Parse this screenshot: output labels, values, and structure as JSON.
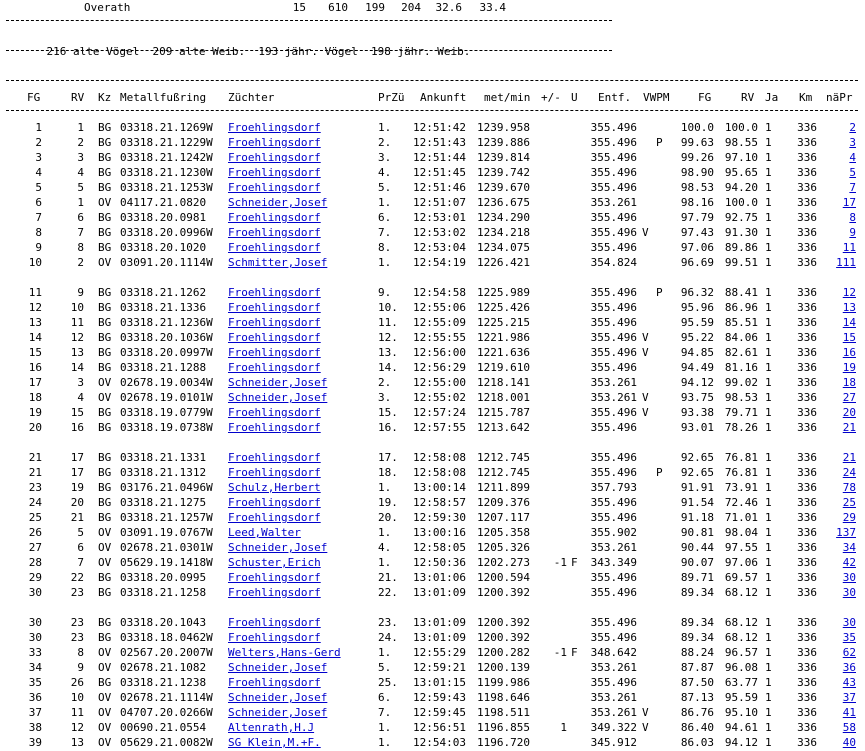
{
  "club_row": {
    "name": "Overath",
    "c1": "15",
    "c2": "610",
    "c3": "199",
    "c4": "204",
    "c5": "32.6",
    "c6": "33.4"
  },
  "summary": "216 alte Vögel  209 alte Weib.  193 jähr. Vögel  198 jähr. Weib.",
  "headers": {
    "fg": "FG",
    "rv": "RV",
    "kz": "Kz",
    "ring": "Metallfußring",
    "zuechter": "Züchter",
    "przue": "PrZü",
    "ankunft": "Ankunft",
    "metmin": "met/min",
    "pm": "+/-",
    "u": "U",
    "entf": "Entf.",
    "vwpm": "VWPM",
    "fg2": "FG",
    "rv2": "RV",
    "ja": "Ja",
    "km": "Km",
    "naepr": "näPr"
  },
  "rows": [
    {
      "fg": "1",
      "rv": "1",
      "kz": "BG",
      "ring": "03318.21.1269W",
      "breeder": "Froehlingsdorf",
      "prz": "1.",
      "time": "12:51:42",
      "speed": "1239.958",
      "pm": "",
      "u": "",
      "dist": "355.496",
      "v": "",
      "p": "",
      "fg2": "100.0",
      "rv2": "100.0",
      "ja": "1",
      "km": "336",
      "np": "2"
    },
    {
      "fg": "2",
      "rv": "2",
      "kz": "BG",
      "ring": "03318.21.1229W",
      "breeder": "Froehlingsdorf",
      "prz": "2.",
      "time": "12:51:43",
      "speed": "1239.886",
      "pm": "",
      "u": "",
      "dist": "355.496",
      "v": "",
      "p": "P",
      "fg2": "99.63",
      "rv2": "98.55",
      "ja": "1",
      "km": "336",
      "np": "3"
    },
    {
      "fg": "3",
      "rv": "3",
      "kz": "BG",
      "ring": "03318.21.1242W",
      "breeder": "Froehlingsdorf",
      "prz": "3.",
      "time": "12:51:44",
      "speed": "1239.814",
      "pm": "",
      "u": "",
      "dist": "355.496",
      "v": "",
      "p": "",
      "fg2": "99.26",
      "rv2": "97.10",
      "ja": "1",
      "km": "336",
      "np": "4"
    },
    {
      "fg": "4",
      "rv": "4",
      "kz": "BG",
      "ring": "03318.21.1230W",
      "breeder": "Froehlingsdorf",
      "prz": "4.",
      "time": "12:51:45",
      "speed": "1239.742",
      "pm": "",
      "u": "",
      "dist": "355.496",
      "v": "",
      "p": "",
      "fg2": "98.90",
      "rv2": "95.65",
      "ja": "1",
      "km": "336",
      "np": "5"
    },
    {
      "fg": "5",
      "rv": "5",
      "kz": "BG",
      "ring": "03318.21.1253W",
      "breeder": "Froehlingsdorf",
      "prz": "5.",
      "time": "12:51:46",
      "speed": "1239.670",
      "pm": "",
      "u": "",
      "dist": "355.496",
      "v": "",
      "p": "",
      "fg2": "98.53",
      "rv2": "94.20",
      "ja": "1",
      "km": "336",
      "np": "7"
    },
    {
      "fg": "6",
      "rv": "1",
      "kz": "OV",
      "ring": "04117.21.0820",
      "breeder": "Schneider,Josef",
      "prz": "1.",
      "time": "12:51:07",
      "speed": "1236.675",
      "pm": "",
      "u": "",
      "dist": "353.261",
      "v": "",
      "p": "",
      "fg2": "98.16",
      "rv2": "100.0",
      "ja": "1",
      "km": "336",
      "np": "17"
    },
    {
      "fg": "7",
      "rv": "6",
      "kz": "BG",
      "ring": "03318.20.0981",
      "breeder": "Froehlingsdorf",
      "prz": "6.",
      "time": "12:53:01",
      "speed": "1234.290",
      "pm": "",
      "u": "",
      "dist": "355.496",
      "v": "",
      "p": "",
      "fg2": "97.79",
      "rv2": "92.75",
      "ja": "1",
      "km": "336",
      "np": "8"
    },
    {
      "fg": "8",
      "rv": "7",
      "kz": "BG",
      "ring": "03318.20.0996W",
      "breeder": "Froehlingsdorf",
      "prz": "7.",
      "time": "12:53:02",
      "speed": "1234.218",
      "pm": "",
      "u": "",
      "dist": "355.496",
      "v": "V",
      "p": "",
      "fg2": "97.43",
      "rv2": "91.30",
      "ja": "1",
      "km": "336",
      "np": "9"
    },
    {
      "fg": "9",
      "rv": "8",
      "kz": "BG",
      "ring": "03318.20.1020",
      "breeder": "Froehlingsdorf",
      "prz": "8.",
      "time": "12:53:04",
      "speed": "1234.075",
      "pm": "",
      "u": "",
      "dist": "355.496",
      "v": "",
      "p": "",
      "fg2": "97.06",
      "rv2": "89.86",
      "ja": "1",
      "km": "336",
      "np": "11"
    },
    {
      "fg": "10",
      "rv": "2",
      "kz": "OV",
      "ring": "03091.20.1114W",
      "breeder": "Schmitter,Josef",
      "prz": "1.",
      "time": "12:54:19",
      "speed": "1226.421",
      "pm": "",
      "u": "",
      "dist": "354.824",
      "v": "",
      "p": "",
      "fg2": "96.69",
      "rv2": "99.51",
      "ja": "1",
      "km": "336",
      "np": "111"
    },
    {
      "fg": "11",
      "rv": "9",
      "kz": "BG",
      "ring": "03318.21.1262",
      "breeder": "Froehlingsdorf",
      "prz": "9.",
      "time": "12:54:58",
      "speed": "1225.989",
      "pm": "",
      "u": "",
      "dist": "355.496",
      "v": "",
      "p": "P",
      "fg2": "96.32",
      "rv2": "88.41",
      "ja": "1",
      "km": "336",
      "np": "12"
    },
    {
      "fg": "12",
      "rv": "10",
      "kz": "BG",
      "ring": "03318.21.1336",
      "breeder": "Froehlingsdorf",
      "prz": "10.",
      "time": "12:55:06",
      "speed": "1225.426",
      "pm": "",
      "u": "",
      "dist": "355.496",
      "v": "",
      "p": "",
      "fg2": "95.96",
      "rv2": "86.96",
      "ja": "1",
      "km": "336",
      "np": "13"
    },
    {
      "fg": "13",
      "rv": "11",
      "kz": "BG",
      "ring": "03318.21.1236W",
      "breeder": "Froehlingsdorf",
      "prz": "11.",
      "time": "12:55:09",
      "speed": "1225.215",
      "pm": "",
      "u": "",
      "dist": "355.496",
      "v": "",
      "p": "",
      "fg2": "95.59",
      "rv2": "85.51",
      "ja": "1",
      "km": "336",
      "np": "14"
    },
    {
      "fg": "14",
      "rv": "12",
      "kz": "BG",
      "ring": "03318.20.1036W",
      "breeder": "Froehlingsdorf",
      "prz": "12.",
      "time": "12:55:55",
      "speed": "1221.986",
      "pm": "",
      "u": "",
      "dist": "355.496",
      "v": "V",
      "p": "",
      "fg2": "95.22",
      "rv2": "84.06",
      "ja": "1",
      "km": "336",
      "np": "15"
    },
    {
      "fg": "15",
      "rv": "13",
      "kz": "BG",
      "ring": "03318.20.0997W",
      "breeder": "Froehlingsdorf",
      "prz": "13.",
      "time": "12:56:00",
      "speed": "1221.636",
      "pm": "",
      "u": "",
      "dist": "355.496",
      "v": "V",
      "p": "",
      "fg2": "94.85",
      "rv2": "82.61",
      "ja": "1",
      "km": "336",
      "np": "16"
    },
    {
      "fg": "16",
      "rv": "14",
      "kz": "BG",
      "ring": "03318.21.1288",
      "breeder": "Froehlingsdorf",
      "prz": "14.",
      "time": "12:56:29",
      "speed": "1219.610",
      "pm": "",
      "u": "",
      "dist": "355.496",
      "v": "",
      "p": "",
      "fg2": "94.49",
      "rv2": "81.16",
      "ja": "1",
      "km": "336",
      "np": "19"
    },
    {
      "fg": "17",
      "rv": "3",
      "kz": "OV",
      "ring": "02678.19.0034W",
      "breeder": "Schneider,Josef",
      "prz": "2.",
      "time": "12:55:00",
      "speed": "1218.141",
      "pm": "",
      "u": "",
      "dist": "353.261",
      "v": "",
      "p": "",
      "fg2": "94.12",
      "rv2": "99.02",
      "ja": "1",
      "km": "336",
      "np": "18"
    },
    {
      "fg": "18",
      "rv": "4",
      "kz": "OV",
      "ring": "02678.19.0101W",
      "breeder": "Schneider,Josef",
      "prz": "3.",
      "time": "12:55:02",
      "speed": "1218.001",
      "pm": "",
      "u": "",
      "dist": "353.261",
      "v": "V",
      "p": "",
      "fg2": "93.75",
      "rv2": "98.53",
      "ja": "1",
      "km": "336",
      "np": "27"
    },
    {
      "fg": "19",
      "rv": "15",
      "kz": "BG",
      "ring": "03318.19.0779W",
      "breeder": "Froehlingsdorf",
      "prz": "15.",
      "time": "12:57:24",
      "speed": "1215.787",
      "pm": "",
      "u": "",
      "dist": "355.496",
      "v": "V",
      "p": "",
      "fg2": "93.38",
      "rv2": "79.71",
      "ja": "1",
      "km": "336",
      "np": "20"
    },
    {
      "fg": "20",
      "rv": "16",
      "kz": "BG",
      "ring": "03318.19.0738W",
      "breeder": "Froehlingsdorf",
      "prz": "16.",
      "time": "12:57:55",
      "speed": "1213.642",
      "pm": "",
      "u": "",
      "dist": "355.496",
      "v": "",
      "p": "",
      "fg2": "93.01",
      "rv2": "78.26",
      "ja": "1",
      "km": "336",
      "np": "21"
    },
    {
      "fg": "21",
      "rv": "17",
      "kz": "BG",
      "ring": "03318.21.1331",
      "breeder": "Froehlingsdorf",
      "prz": "17.",
      "time": "12:58:08",
      "speed": "1212.745",
      "pm": "",
      "u": "",
      "dist": "355.496",
      "v": "",
      "p": "",
      "fg2": "92.65",
      "rv2": "76.81",
      "ja": "1",
      "km": "336",
      "np": "21"
    },
    {
      "fg": "21",
      "rv": "17",
      "kz": "BG",
      "ring": "03318.21.1312",
      "breeder": "Froehlingsdorf",
      "prz": "18.",
      "time": "12:58:08",
      "speed": "1212.745",
      "pm": "",
      "u": "",
      "dist": "355.496",
      "v": "",
      "p": "P",
      "fg2": "92.65",
      "rv2": "76.81",
      "ja": "1",
      "km": "336",
      "np": "24"
    },
    {
      "fg": "23",
      "rv": "19",
      "kz": "BG",
      "ring": "03176.21.0496W",
      "breeder": "Schulz,Herbert",
      "prz": "1.",
      "time": "13:00:14",
      "speed": "1211.899",
      "pm": "",
      "u": "",
      "dist": "357.793",
      "v": "",
      "p": "",
      "fg2": "91.91",
      "rv2": "73.91",
      "ja": "1",
      "km": "336",
      "np": "78"
    },
    {
      "fg": "24",
      "rv": "20",
      "kz": "BG",
      "ring": "03318.21.1275",
      "breeder": "Froehlingsdorf",
      "prz": "19.",
      "time": "12:58:57",
      "speed": "1209.376",
      "pm": "",
      "u": "",
      "dist": "355.496",
      "v": "",
      "p": "",
      "fg2": "91.54",
      "rv2": "72.46",
      "ja": "1",
      "km": "336",
      "np": "25"
    },
    {
      "fg": "25",
      "rv": "21",
      "kz": "BG",
      "ring": "03318.21.1257W",
      "breeder": "Froehlingsdorf",
      "prz": "20.",
      "time": "12:59:30",
      "speed": "1207.117",
      "pm": "",
      "u": "",
      "dist": "355.496",
      "v": "",
      "p": "",
      "fg2": "91.18",
      "rv2": "71.01",
      "ja": "1",
      "km": "336",
      "np": "29"
    },
    {
      "fg": "26",
      "rv": "5",
      "kz": "OV",
      "ring": "03091.19.0767W",
      "breeder": "Leed,Walter",
      "prz": "1.",
      "time": "13:00:16",
      "speed": "1205.358",
      "pm": "",
      "u": "",
      "dist": "355.902",
      "v": "",
      "p": "",
      "fg2": "90.81",
      "rv2": "98.04",
      "ja": "1",
      "km": "336",
      "np": "137"
    },
    {
      "fg": "27",
      "rv": "6",
      "kz": "OV",
      "ring": "02678.21.0301W",
      "breeder": "Schneider,Josef",
      "prz": "4.",
      "time": "12:58:05",
      "speed": "1205.326",
      "pm": "",
      "u": "",
      "dist": "353.261",
      "v": "",
      "p": "",
      "fg2": "90.44",
      "rv2": "97.55",
      "ja": "1",
      "km": "336",
      "np": "34"
    },
    {
      "fg": "28",
      "rv": "7",
      "kz": "OV",
      "ring": "05629.19.1418W",
      "breeder": "Schuster,Erich",
      "prz": "1.",
      "time": "12:50:36",
      "speed": "1202.273",
      "pm": "-1",
      "u": "F",
      "dist": "343.349",
      "v": "",
      "p": "",
      "fg2": "90.07",
      "rv2": "97.06",
      "ja": "1",
      "km": "336",
      "np": "42"
    },
    {
      "fg": "29",
      "rv": "22",
      "kz": "BG",
      "ring": "03318.20.0995",
      "breeder": "Froehlingsdorf",
      "prz": "21.",
      "time": "13:01:06",
      "speed": "1200.594",
      "pm": "",
      "u": "",
      "dist": "355.496",
      "v": "",
      "p": "",
      "fg2": "89.71",
      "rv2": "69.57",
      "ja": "1",
      "km": "336",
      "np": "30"
    },
    {
      "fg": "30",
      "rv": "23",
      "kz": "BG",
      "ring": "03318.21.1258",
      "breeder": "Froehlingsdorf",
      "prz": "22.",
      "time": "13:01:09",
      "speed": "1200.392",
      "pm": "",
      "u": "",
      "dist": "355.496",
      "v": "",
      "p": "",
      "fg2": "89.34",
      "rv2": "68.12",
      "ja": "1",
      "km": "336",
      "np": "30"
    },
    {
      "fg": "30",
      "rv": "23",
      "kz": "BG",
      "ring": "03318.20.1043",
      "breeder": "Froehlingsdorf",
      "prz": "23.",
      "time": "13:01:09",
      "speed": "1200.392",
      "pm": "",
      "u": "",
      "dist": "355.496",
      "v": "",
      "p": "",
      "fg2": "89.34",
      "rv2": "68.12",
      "ja": "1",
      "km": "336",
      "np": "30"
    },
    {
      "fg": "30",
      "rv": "23",
      "kz": "BG",
      "ring": "03318.18.0462W",
      "breeder": "Froehlingsdorf",
      "prz": "24.",
      "time": "13:01:09",
      "speed": "1200.392",
      "pm": "",
      "u": "",
      "dist": "355.496",
      "v": "",
      "p": "",
      "fg2": "89.34",
      "rv2": "68.12",
      "ja": "1",
      "km": "336",
      "np": "35"
    },
    {
      "fg": "33",
      "rv": "8",
      "kz": "OV",
      "ring": "02567.20.2007W",
      "breeder": "Welters,Hans-Gerd",
      "prz": "1.",
      "time": "12:55:29",
      "speed": "1200.282",
      "pm": "-1",
      "u": "F",
      "dist": "348.642",
      "v": "",
      "p": "",
      "fg2": "88.24",
      "rv2": "96.57",
      "ja": "1",
      "km": "336",
      "np": "62"
    },
    {
      "fg": "34",
      "rv": "9",
      "kz": "OV",
      "ring": "02678.21.1082",
      "breeder": "Schneider,Josef",
      "prz": "5.",
      "time": "12:59:21",
      "speed": "1200.139",
      "pm": "",
      "u": "",
      "dist": "353.261",
      "v": "",
      "p": "",
      "fg2": "87.87",
      "rv2": "96.08",
      "ja": "1",
      "km": "336",
      "np": "36"
    },
    {
      "fg": "35",
      "rv": "26",
      "kz": "BG",
      "ring": "03318.21.1238",
      "breeder": "Froehlingsdorf",
      "prz": "25.",
      "time": "13:01:15",
      "speed": "1199.986",
      "pm": "",
      "u": "",
      "dist": "355.496",
      "v": "",
      "p": "",
      "fg2": "87.50",
      "rv2": "63.77",
      "ja": "1",
      "km": "336",
      "np": "43"
    },
    {
      "fg": "36",
      "rv": "10",
      "kz": "OV",
      "ring": "02678.21.1114W",
      "breeder": "Schneider,Josef",
      "prz": "6.",
      "time": "12:59:43",
      "speed": "1198.646",
      "pm": "",
      "u": "",
      "dist": "353.261",
      "v": "",
      "p": "",
      "fg2": "87.13",
      "rv2": "95.59",
      "ja": "1",
      "km": "336",
      "np": "37"
    },
    {
      "fg": "37",
      "rv": "11",
      "kz": "OV",
      "ring": "04707.20.0266W",
      "breeder": "Schneider,Josef",
      "prz": "7.",
      "time": "12:59:45",
      "speed": "1198.511",
      "pm": "",
      "u": "",
      "dist": "353.261",
      "v": "V",
      "p": "",
      "fg2": "86.76",
      "rv2": "95.10",
      "ja": "1",
      "km": "336",
      "np": "41"
    },
    {
      "fg": "38",
      "rv": "12",
      "kz": "OV",
      "ring": "00690.21.0554",
      "breeder": "Altenrath,H.J",
      "prz": "1.",
      "time": "12:56:51",
      "speed": "1196.855",
      "pm": "1",
      "u": "",
      "dist": "349.322",
      "v": "V",
      "p": "",
      "fg2": "86.40",
      "rv2": "94.61",
      "ja": "1",
      "km": "336",
      "np": "58"
    },
    {
      "fg": "39",
      "rv": "13",
      "kz": "OV",
      "ring": "05629.21.0082W",
      "breeder": "SG Klein,M.+F.",
      "prz": "1.",
      "time": "12:54:03",
      "speed": "1196.720",
      "pm": "",
      "u": "",
      "dist": "345.912",
      "v": "",
      "p": "",
      "fg2": "86.03",
      "rv2": "94.12",
      "ja": "1",
      "km": "336",
      "np": "40"
    }
  ]
}
